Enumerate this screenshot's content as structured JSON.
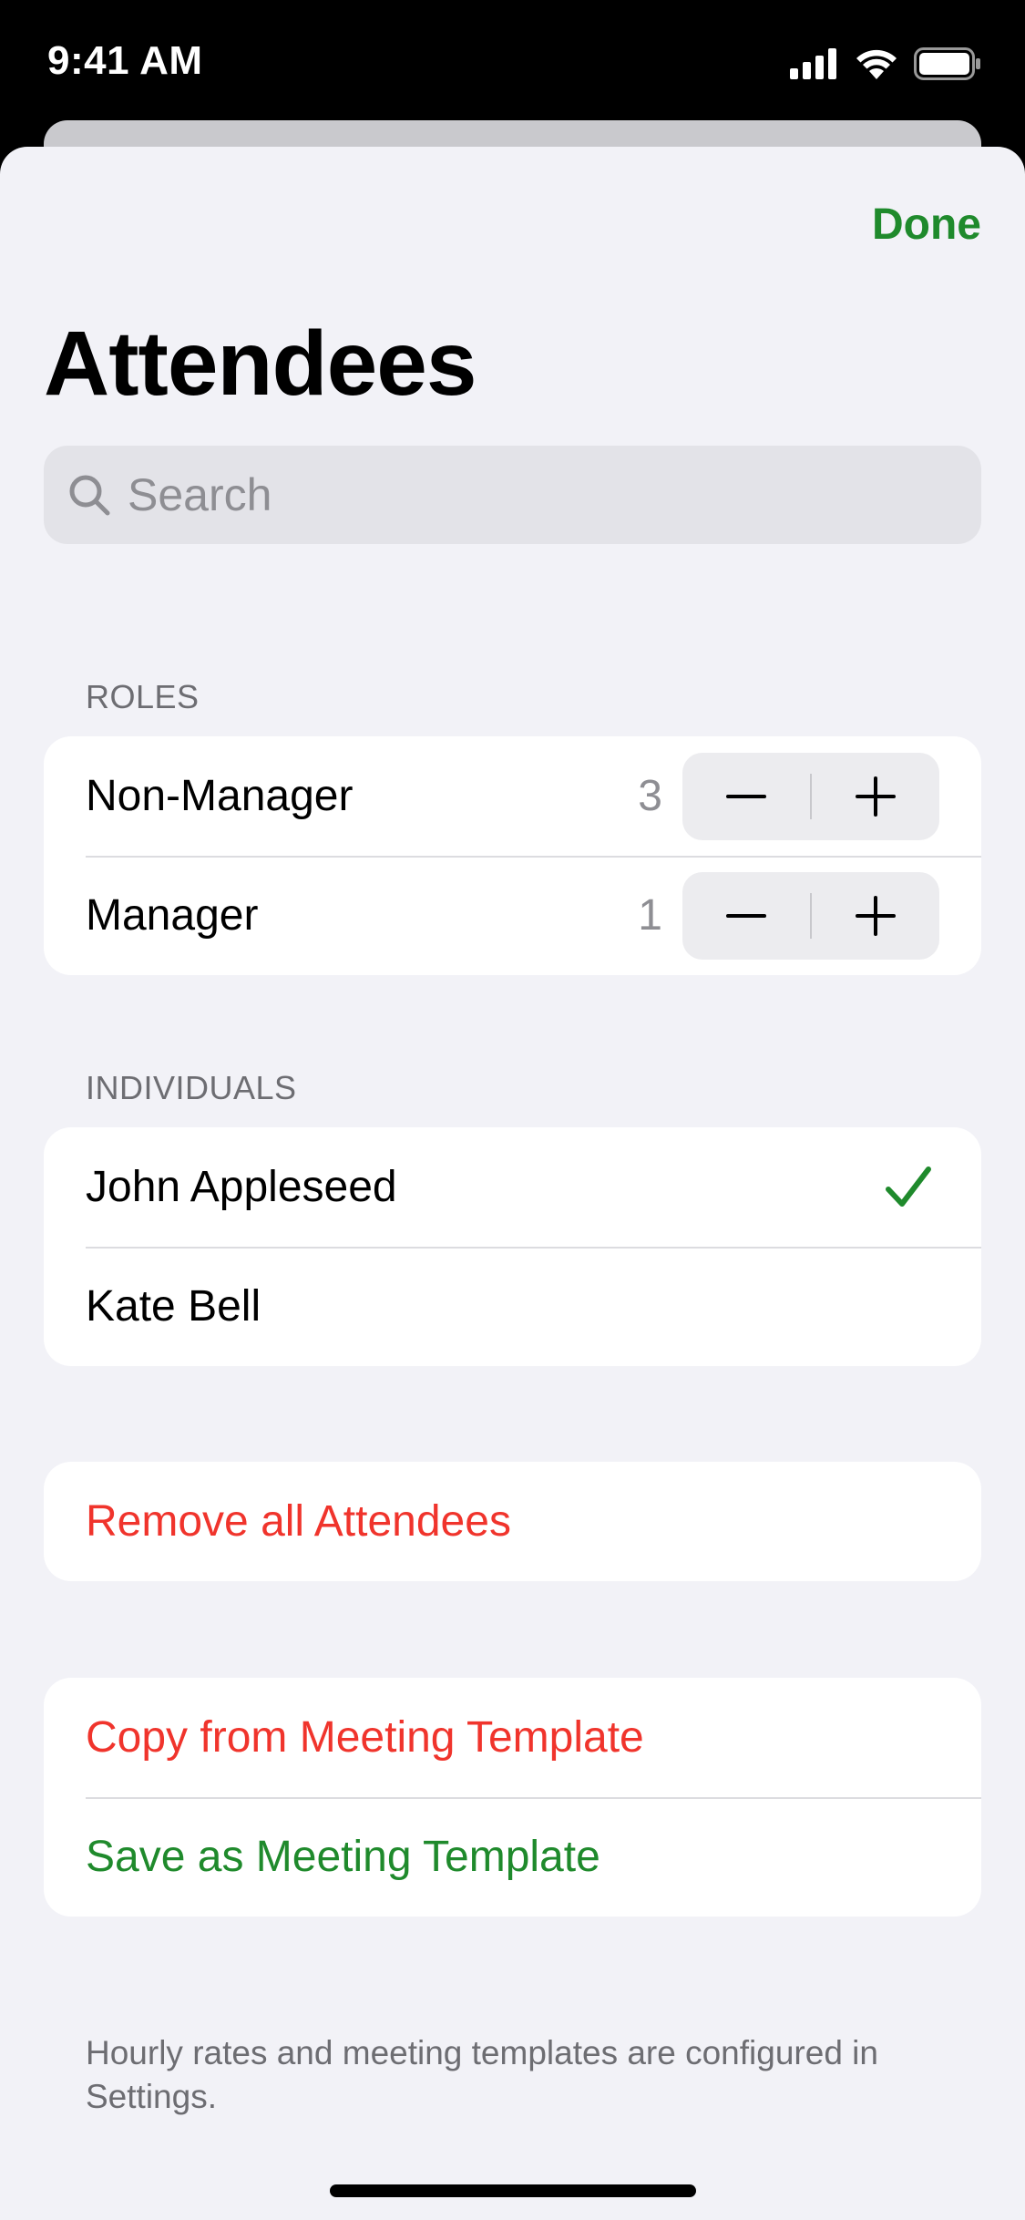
{
  "status_bar": {
    "time": "9:41 AM"
  },
  "header": {
    "done_label": "Done",
    "title": "Attendees"
  },
  "search": {
    "placeholder": "Search",
    "value": ""
  },
  "roles": {
    "header": "ROLES",
    "items": [
      {
        "label": "Non-Manager",
        "count": "3"
      },
      {
        "label": "Manager",
        "count": "1"
      }
    ]
  },
  "individuals": {
    "header": "INDIVIDUALS",
    "items": [
      {
        "label": "John Appleseed",
        "selected": true
      },
      {
        "label": "Kate Bell",
        "selected": false
      }
    ]
  },
  "actions": {
    "remove_all": "Remove all Attendees",
    "copy_template": "Copy from Meeting Template",
    "save_template": "Save as Meeting Template"
  },
  "footer": {
    "note": "Hourly rates and meeting templates are configured in Settings."
  },
  "colors": {
    "accent": "#1f8a2c",
    "destructive": "#f0342c",
    "background": "#f2f2f7"
  },
  "icons": {
    "search": "search-icon",
    "decrement": "minus-icon",
    "increment": "plus-icon",
    "selected": "checkmark-icon",
    "signal": "cellular-signal-icon",
    "wifi": "wifi-icon",
    "battery": "battery-icon"
  }
}
